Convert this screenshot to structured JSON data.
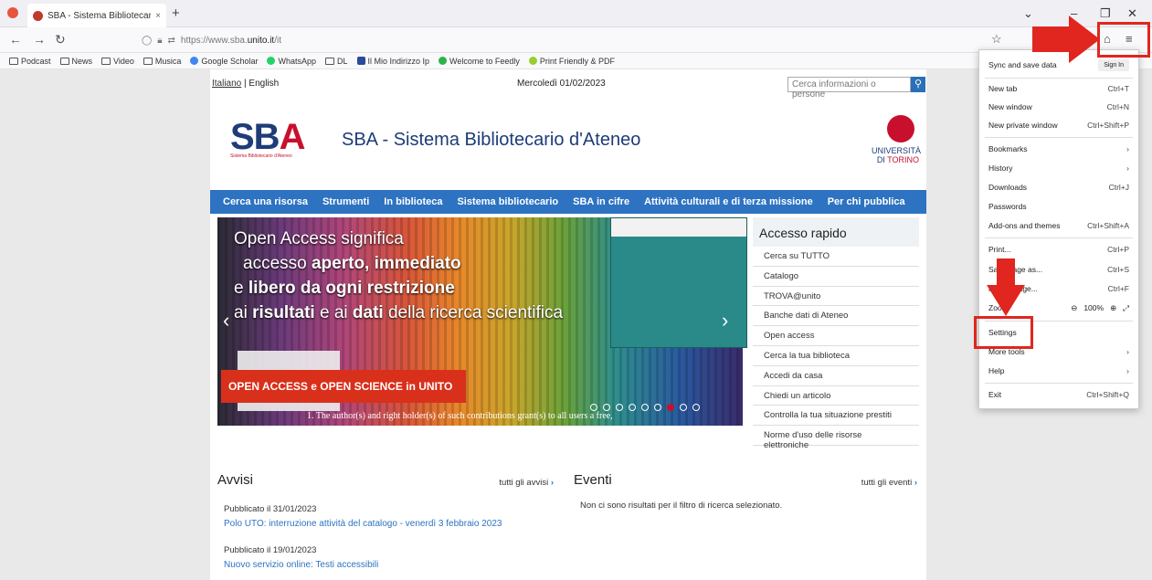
{
  "browser": {
    "tab_title": "SBA - Sistema Bibliotecario d'A",
    "new_tab": "+",
    "url_prefix": "https://www.sba.",
    "url_domain": "unito.it",
    "url_suffix": "/it",
    "bookmarks": [
      "Podcast",
      "News",
      "Video",
      "Musica",
      "Google Scholar",
      "WhatsApp",
      "DL",
      "Il Mio Indirizzo Ip",
      "Welcome to Feedly",
      "Print Friendly & PDF"
    ]
  },
  "page": {
    "lang_it": "Italiano",
    "lang_en": "English",
    "date": "Mercoledì 01/02/2023",
    "search_placeholder": "Cerca informazioni o persone",
    "logo_text": "SB",
    "logo_accent": "A",
    "logo_sub": "Sistema Bibliotecario d'Ateneo",
    "site_title": "SBA - Sistema Bibliotecario d'Ateneo",
    "unito_line1": "UNIVERSITÀ",
    "unito_line2_a": "DI ",
    "unito_line2_b": "TORINO",
    "nav": [
      "Cerca una risorsa",
      "Strumenti",
      "In biblioteca",
      "Sistema bibliotecario",
      "SBA in cifre",
      "Attività culturali e di terza missione",
      "Per chi pubblica"
    ],
    "slide": {
      "l1": "Open Access significa",
      "l2a": "accesso ",
      "l2b": "aperto, immediato",
      "l3a": "e ",
      "l3b": "libero da ogni restrizione",
      "l4a": "ai ",
      "l4b": "risultati",
      "l4c": " e ai ",
      "l4d": "dati",
      "l4e": " della ricerca scientifica",
      "banner": "OPEN ACCESS e OPEN SCIENCE in UNITO",
      "footnote": "1. The author(s) and right holder(s) of such contributions grant(s) to all users a free,"
    },
    "quick": {
      "title": "Accesso rapido",
      "items": [
        "Cerca su TUTTO",
        "Catalogo",
        "TROVA@unito",
        "Banche dati di Ateneo",
        "Open access",
        "Cerca la tua biblioteca",
        "Accedi da casa",
        "Chiedi un articolo",
        "Controlla la tua situazione prestiti",
        "Norme d'uso delle risorse elettroniche"
      ]
    },
    "avvisi": {
      "title": "Avvisi",
      "link": "tutti gli avvisi",
      "pub1": "Pubblicato il 31/01/2023",
      "news1": "Polo UTO: interruzione attività del catalogo - venerdì 3 febbraio 2023",
      "pub2": "Pubblicato il 19/01/2023",
      "news2": "Nuovo servizio online: Testi accessibili"
    },
    "eventi": {
      "title": "Eventi",
      "link": "tutti gli eventi",
      "none": "Non ci sono risultati per il filtro di ricerca selezionato."
    }
  },
  "menu": {
    "sync": "Sync and save data",
    "signin": "Sign In",
    "new_tab": "New tab",
    "new_tab_sc": "Ctrl+T",
    "new_window": "New window",
    "new_window_sc": "Ctrl+N",
    "private": "New private window",
    "private_sc": "Ctrl+Shift+P",
    "bookmarks": "Bookmarks",
    "history": "History",
    "downloads": "Downloads",
    "downloads_sc": "Ctrl+J",
    "passwords": "Passwords",
    "addons": "Add-ons and themes",
    "addons_sc": "Ctrl+Shift+A",
    "print": "Print...",
    "print_sc": "Ctrl+P",
    "save": "Save page as...",
    "save_sc": "Ctrl+S",
    "find": "Find in page...",
    "find_sc": "Ctrl+F",
    "zoom": "Zoom",
    "zoom_val": "100%",
    "settings": "Settings",
    "more_tools": "More tools",
    "help": "Help",
    "exit": "Exit",
    "exit_sc": "Ctrl+Shift+Q"
  },
  "colors": {
    "accent_red": "#e0261e",
    "nav_blue": "#2d73c1",
    "sba_blue": "#1d3c78"
  }
}
